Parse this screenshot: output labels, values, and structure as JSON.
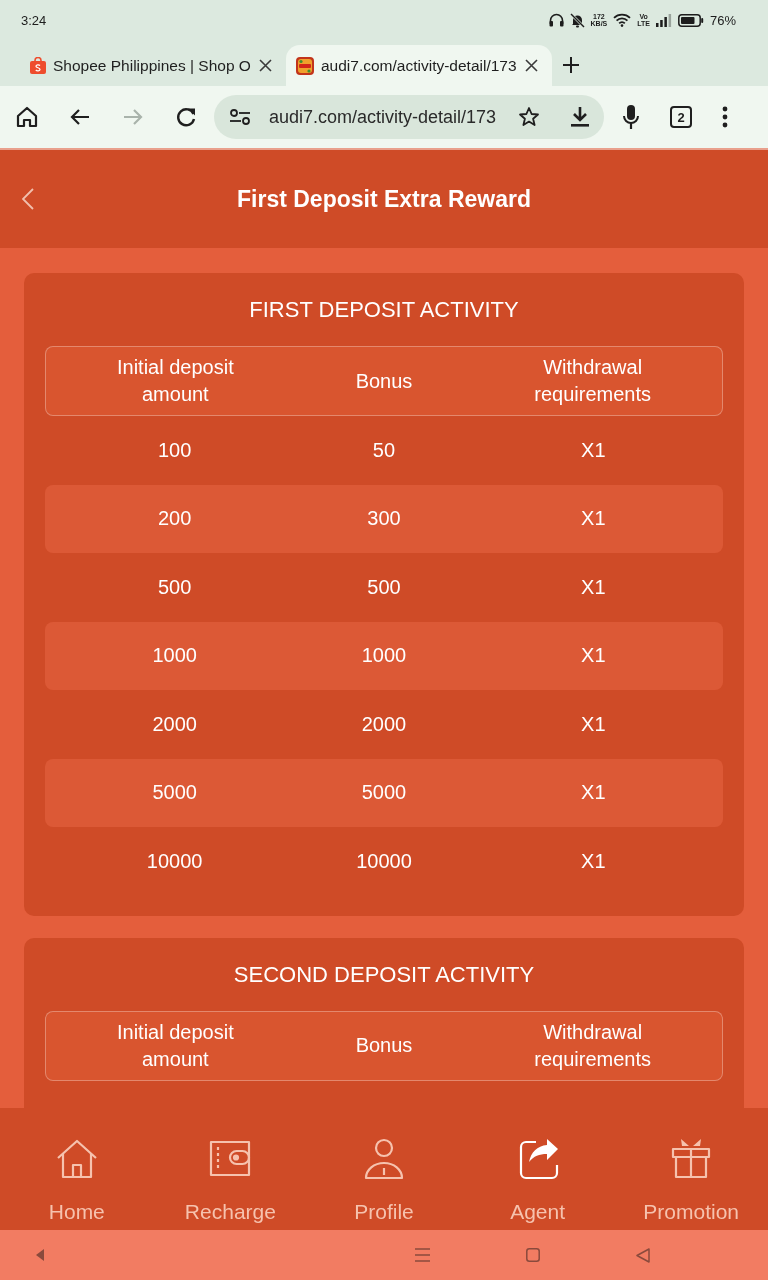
{
  "status_bar": {
    "time": "3:24",
    "network_speed": {
      "value": "172",
      "unit": "KB/S"
    },
    "network_type": {
      "top": "Vo",
      "bottom": "LTE"
    },
    "battery": "76%"
  },
  "browser": {
    "tabs": [
      {
        "kind": "shop",
        "title": "Shopee Philippines | Shop O",
        "selected": false
      },
      {
        "kind": "game",
        "title": "audi7.com/activity-detail/173",
        "selected": true
      }
    ],
    "toolbar": {
      "forward": {
        "disabled": true
      },
      "url": "audi7.com/activity-detail/173",
      "tab_count": "2"
    }
  },
  "header": {
    "title": "First Deposit Extra Reward"
  },
  "activities": [
    {
      "title": "FIRST DEPOSIT ACTIVITY",
      "columns": [
        "Initial deposit amount",
        "Bonus",
        "Withdrawal requirements"
      ],
      "rows": [
        [
          "100",
          "50",
          "X1"
        ],
        [
          "200",
          "300",
          "X1"
        ],
        [
          "500",
          "500",
          "X1"
        ],
        [
          "1000",
          "1000",
          "X1"
        ],
        [
          "2000",
          "2000",
          "X1"
        ],
        [
          "5000",
          "5000",
          "X1"
        ],
        [
          "10000",
          "10000",
          "X1"
        ]
      ]
    },
    {
      "title": "SECOND DEPOSIT ACTIVITY",
      "columns": [
        "Initial deposit amount",
        "Bonus",
        "Withdrawal requirements"
      ]
    }
  ],
  "bottom_nav": [
    {
      "label": "Home",
      "selected": false
    },
    {
      "label": "Recharge",
      "selected": false
    },
    {
      "label": "Profile",
      "selected": false
    },
    {
      "label": "Agent",
      "selected": true
    },
    {
      "label": "Promotion",
      "selected": false
    }
  ]
}
